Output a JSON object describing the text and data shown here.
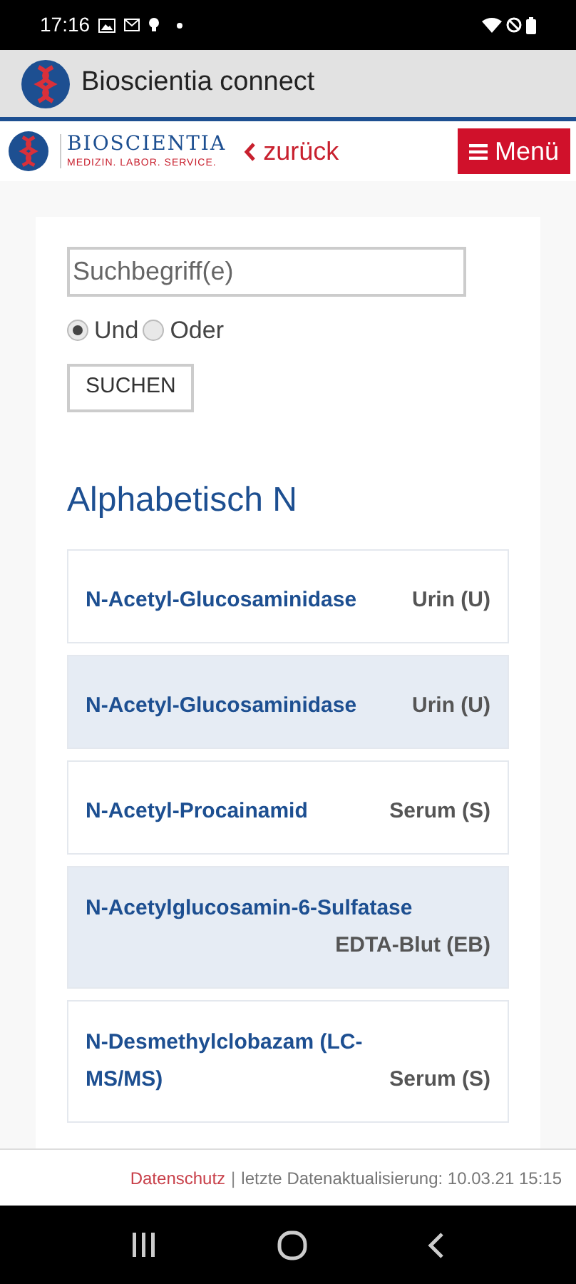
{
  "status_bar": {
    "time": "17:16"
  },
  "app_bar": {
    "title": "Bioscientia connect"
  },
  "header": {
    "brand": "BIOSCIENTIA",
    "tagline": "MEDIZIN. LABOR. SERVICE.",
    "back": "zurück",
    "menu": "Menü"
  },
  "search": {
    "placeholder": "Suchbegriff(e)",
    "options": [
      {
        "label": "Und",
        "selected": true
      },
      {
        "label": "Oder",
        "selected": false
      }
    ],
    "button": "SUCHEN"
  },
  "heading": "Alphabetisch N",
  "results": [
    {
      "name": "N-Acetyl-Glucosaminidase",
      "specimen": "Urin (U)",
      "shaded": false
    },
    {
      "name": "N-Acetyl-Glucosaminidase",
      "specimen": "Urin (U)",
      "shaded": true
    },
    {
      "name": "N-Acetyl-Procainamid",
      "specimen": "Serum (S)",
      "shaded": false
    },
    {
      "name": "N-Acetylglucosamin-6-Sulfatase",
      "specimen": "EDTA-Blut (EB)",
      "shaded": true
    },
    {
      "name": "N-Desmethylclobazam (LC-MS/MS)",
      "specimen": "Serum (S)",
      "shaded": false
    }
  ],
  "footer": {
    "link": "Datenschutz",
    "separator": "|",
    "text": "letzte Datenaktualisierung: 10.03.21 15:15"
  }
}
